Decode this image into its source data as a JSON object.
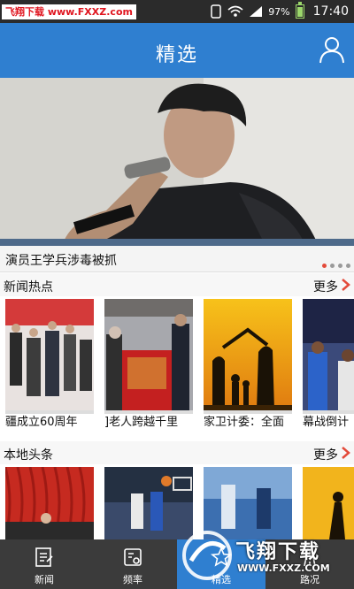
{
  "status_bar": {
    "watermark": "飞翔下载 www.FXXZ.com",
    "battery_percent": "97%",
    "time": "17:40"
  },
  "header": {
    "title": "精选",
    "user_icon": "user-icon"
  },
  "hero": {
    "caption": "演员王学兵涉毒被抓",
    "slide_count": 4,
    "active_slide": 1
  },
  "news_hot": {
    "title": "新闻热点",
    "more": "更多",
    "items": [
      {
        "caption": "疆成立60周年"
      },
      {
        "caption": "]老人跨越千里"
      },
      {
        "caption": "家卫计委：全面"
      },
      {
        "caption": "幕战倒计"
      }
    ]
  },
  "local_headlines": {
    "title": "本地头条",
    "more": "更多"
  },
  "bottom_nav": {
    "items": [
      {
        "label": "新闻",
        "icon": "news-icon"
      },
      {
        "label": "频率",
        "icon": "radio-icon"
      },
      {
        "label": "精选",
        "icon": "star-icon"
      },
      {
        "label": "路况",
        "icon": "traffic-icon"
      }
    ],
    "active_index": 2
  },
  "watermark_bottom": {
    "text": "飞翔下载",
    "url": "WWW.FXXZ.COM"
  },
  "colors": {
    "brand_blue": "#2f7fd0",
    "accent_red": "#e34a3a",
    "nav_dark": "#3b3b3b"
  }
}
